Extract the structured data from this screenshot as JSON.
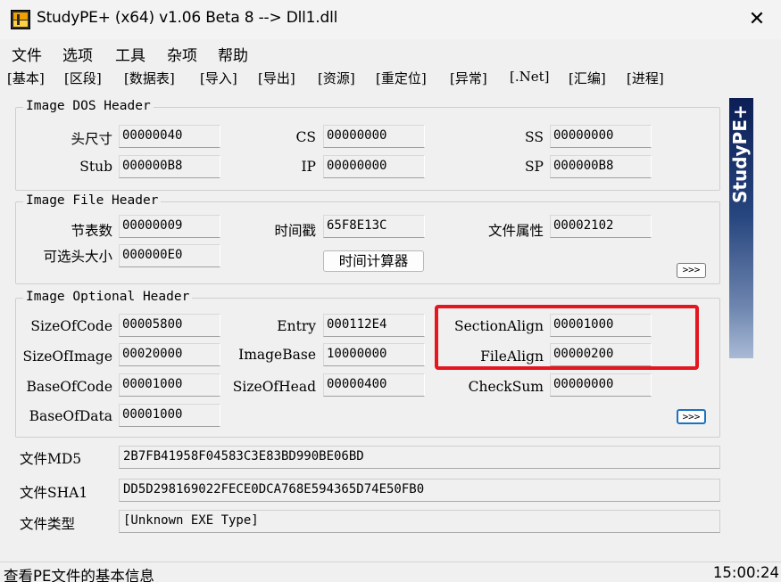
{
  "window": {
    "title": "StudyPE+ (x64) v1.06 Beta 8  --> Dll1.dll",
    "close_label": "✕"
  },
  "menu": [
    "文件",
    "选项",
    "工具",
    "杂项",
    "帮助"
  ],
  "tabs": [
    "[基本]",
    "[区段]",
    "[数据表]",
    "[导入]",
    "[导出]",
    "[资源]",
    "[重定位]",
    "[异常]",
    "[.Net]",
    "[汇编]",
    "[进程]"
  ],
  "dos_header": {
    "title": "Image DOS Header",
    "head_size": {
      "label": "头尺寸",
      "value": "00000040"
    },
    "cs": {
      "label": "CS",
      "value": "00000000"
    },
    "ss": {
      "label": "SS",
      "value": "00000000"
    },
    "stub": {
      "label": "Stub",
      "value": "000000B8"
    },
    "ip": {
      "label": "IP",
      "value": "00000000"
    },
    "sp": {
      "label": "SP",
      "value": "000000B8"
    }
  },
  "file_header": {
    "title": "Image File Header",
    "sections": {
      "label": "节表数",
      "value": "00000009"
    },
    "timestamp": {
      "label": "时间戳",
      "value": "65F8E13C"
    },
    "characteristics": {
      "label": "文件属性",
      "value": "00002102"
    },
    "opt_header_size": {
      "label": "可选头大小",
      "value": "000000E0"
    },
    "time_calc_button": "时间计算器",
    "more_button": ">>>"
  },
  "optional_header": {
    "title": "Image Optional Header",
    "size_of_code": {
      "label": "SizeOfCode",
      "value": "00005800"
    },
    "entry": {
      "label": "Entry",
      "value": "000112E4"
    },
    "section_align": {
      "label": "SectionAlign",
      "value": "00001000"
    },
    "size_of_image": {
      "label": "SizeOfImage",
      "value": "00020000"
    },
    "image_base": {
      "label": "ImageBase",
      "value": "10000000"
    },
    "file_align": {
      "label": "FileAlign",
      "value": "00000200"
    },
    "base_of_code": {
      "label": "BaseOfCode",
      "value": "00001000"
    },
    "size_of_head": {
      "label": "SizeOfHead",
      "value": "00000400"
    },
    "checksum": {
      "label": "CheckSum",
      "value": "00000000"
    },
    "base_of_data": {
      "label": "BaseOfData",
      "value": "00001000"
    },
    "more_button": ">>>"
  },
  "file_info": {
    "md5": {
      "label": "文件MD5",
      "value": "2B7FB41958F04583C3E83BD990BE06BD"
    },
    "sha1": {
      "label": "文件SHA1",
      "value": "DD5D298169022FECE0DCA768E594365D74E50FB0"
    },
    "type": {
      "label": "文件类型",
      "value": "[Unknown EXE Type]"
    }
  },
  "side_banner": "StudyPE+",
  "status": {
    "message": "查看PE文件的基本信息",
    "time": "15:00:24"
  },
  "colors": {
    "highlight": "#e4161f",
    "banner_top": "#0c1e56",
    "banner_bottom": "#a9bad6"
  }
}
